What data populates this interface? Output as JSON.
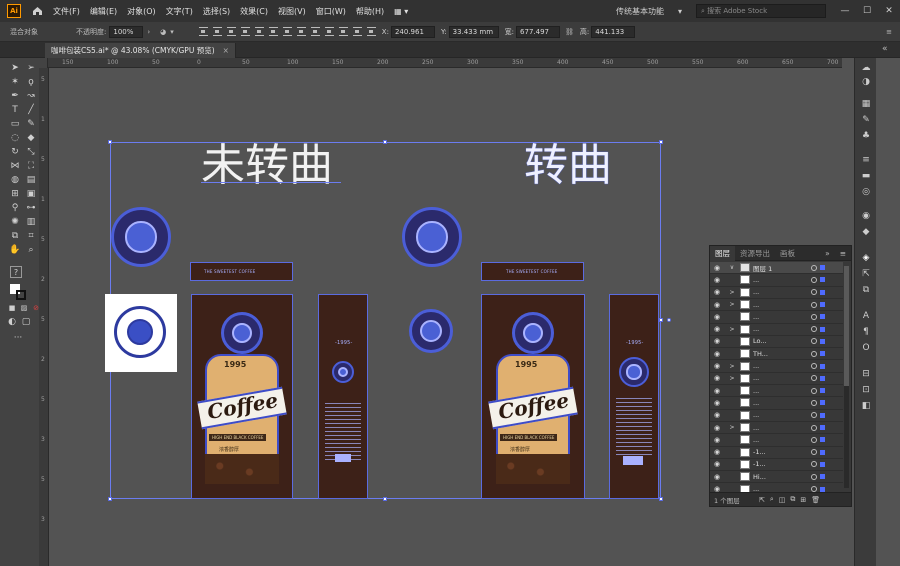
{
  "app": {
    "logo": "Ai"
  },
  "menu": [
    "文件(F)",
    "编辑(E)",
    "对象(O)",
    "文字(T)",
    "选择(S)",
    "效果(C)",
    "视图(V)",
    "窗口(W)",
    "帮助(H)"
  ],
  "workspace": "传统基本功能",
  "search": {
    "placeholder": "搜索 Adobe Stock"
  },
  "control": {
    "mode": "混合对象",
    "opacity_label": "不透明度:",
    "opacity": "100%",
    "x_label": "X:",
    "x": "240.961",
    "y_label": "Y:",
    "y": "33.433 mm",
    "w_label": "宽:",
    "w": "677.497",
    "h_label": "高:",
    "h": "441.133"
  },
  "document_tab": {
    "title": "咖啡包装CS5.ai* @ 43.08% (CMYK/GPU 预览)",
    "close": "×"
  },
  "ruler_h": [
    "150",
    "100",
    "50",
    "0",
    "50",
    "100",
    "150",
    "200",
    "250",
    "300",
    "350",
    "400",
    "450",
    "500",
    "550",
    "600",
    "650",
    "700"
  ],
  "ruler_v": [
    "5",
    "1",
    "5",
    "1",
    "5",
    "2",
    "5",
    "2",
    "5",
    "3",
    "5",
    "3"
  ],
  "canvas": {
    "title_left": "未转曲",
    "title_right": "转曲",
    "label_strip": "THE SWEETEST COFFEE",
    "big_year": "1995",
    "bag_title": "Coffee",
    "bag_sub": "HIGH END BLACK COFFEE",
    "bag_cn": "浓香醇厚",
    "side_year": "-1995-"
  },
  "layers": {
    "tabs": [
      "图层",
      "资源导出",
      "画板"
    ],
    "menu_glyph": "≡",
    "rows": [
      {
        "name": "图层 1",
        "twirl": "∨",
        "eye": "◉"
      },
      {
        "name": "...",
        "twirl": "",
        "eye": "◉"
      },
      {
        "name": "...",
        "twirl": ">",
        "eye": "◉"
      },
      {
        "name": "...",
        "twirl": ">",
        "eye": "◉"
      },
      {
        "name": "...",
        "twirl": "",
        "eye": "◉"
      },
      {
        "name": "...",
        "twirl": ">",
        "eye": "◉"
      },
      {
        "name": "Lo...",
        "twirl": "",
        "eye": "◉"
      },
      {
        "name": "TH...",
        "twirl": "",
        "eye": "◉"
      },
      {
        "name": "...",
        "twirl": ">",
        "eye": "◉"
      },
      {
        "name": "...",
        "twirl": ">",
        "eye": "◉"
      },
      {
        "name": "...",
        "twirl": "",
        "eye": "◉"
      },
      {
        "name": "...",
        "twirl": "",
        "eye": "◉"
      },
      {
        "name": "...",
        "twirl": "",
        "eye": "◉"
      },
      {
        "name": "...",
        "twirl": ">",
        "eye": "◉"
      },
      {
        "name": "...",
        "twirl": "",
        "eye": "◉"
      },
      {
        "name": "-1...",
        "twirl": "",
        "eye": "◉"
      },
      {
        "name": "-1...",
        "twirl": "",
        "eye": "◉"
      },
      {
        "name": "Hi...",
        "twirl": "",
        "eye": "◉"
      },
      {
        "name": "...",
        "twirl": "",
        "eye": "◉"
      }
    ],
    "count": "1 个图层"
  }
}
